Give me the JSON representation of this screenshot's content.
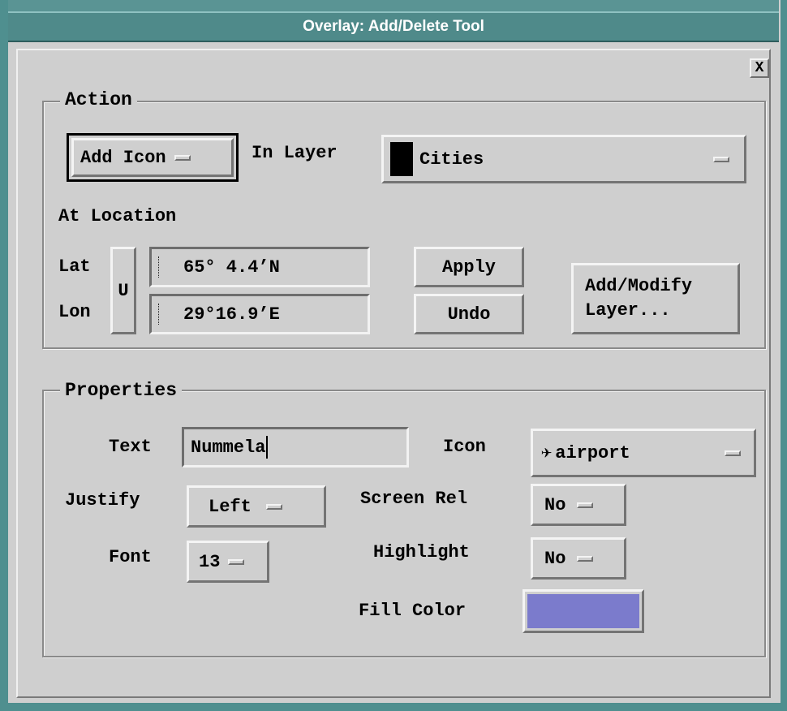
{
  "window": {
    "title": "Overlay: Add/Delete Tool",
    "close_label": "X"
  },
  "action": {
    "group_title": "Action",
    "mode_button": "Add Icon",
    "in_layer_label": "In Layer",
    "layer_value": "Cities",
    "at_location_label": "At Location",
    "lat_label": "Lat",
    "lon_label": "Lon",
    "units_button": "U",
    "lat_value": "65° 4.4’N",
    "lon_value": "29°16.9’E",
    "apply_button": "Apply",
    "undo_button": "Undo",
    "add_modify_line1": "Add/Modify",
    "add_modify_line2": "Layer..."
  },
  "properties": {
    "group_title": "Properties",
    "text_label": "Text",
    "text_value": "Nummela",
    "icon_label": "Icon",
    "icon_value": "airport",
    "justify_label": "Justify",
    "justify_value": "Left",
    "screen_rel_label": "Screen Rel",
    "screen_rel_value": "No",
    "font_label": "Font",
    "font_value": "13",
    "highlight_label": "Highlight",
    "highlight_value": "No",
    "fill_color_label": "Fill Color",
    "fill_color": "#7b7bcc"
  },
  "colors": {
    "title_bar": "#4f8a8a",
    "background": "#cfcfcf"
  },
  "icons": {
    "icon_glyph": "airplane-icon",
    "layer_swatch": "black-swatch"
  }
}
